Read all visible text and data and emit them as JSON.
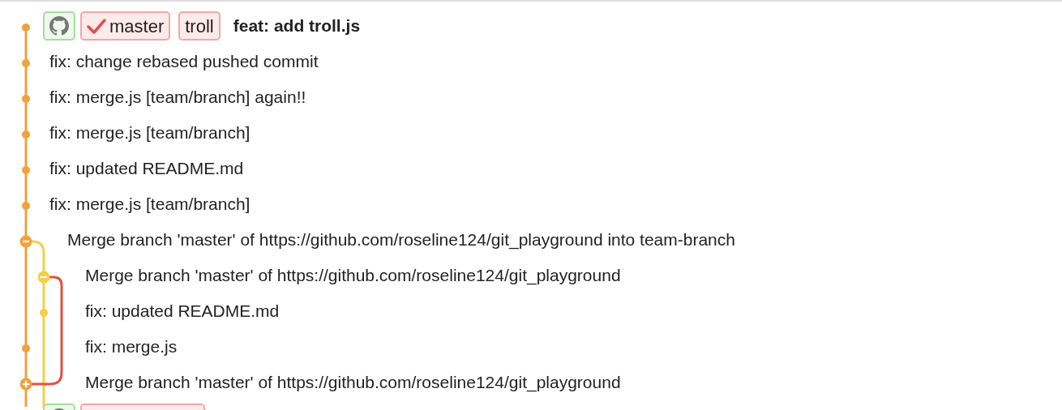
{
  "commits": [
    {
      "message": "feat: add troll.js",
      "bold": true,
      "kind": "commit",
      "tags": [
        {
          "kind": "github"
        },
        {
          "kind": "branch",
          "label": "master",
          "checked": true
        },
        {
          "kind": "branch",
          "label": "troll",
          "checked": false
        }
      ]
    },
    {
      "message": "fix: change rebased pushed commit",
      "bold": false,
      "kind": "commit"
    },
    {
      "message": "fix: merge.js [team/branch] again!!",
      "bold": false,
      "kind": "commit"
    },
    {
      "message": "fix: merge.js [team/branch]",
      "bold": false,
      "kind": "commit"
    },
    {
      "message": "fix: updated README.md",
      "bold": false,
      "kind": "commit"
    },
    {
      "message": "fix: merge.js [team/branch]",
      "bold": false,
      "kind": "commit"
    },
    {
      "message": "Merge branch 'master' of https://github.com/roseline124/git_playground into team-branch",
      "bold": false,
      "kind": "fork",
      "children": [
        {
          "message": "Merge branch 'master' of https://github.com/roseline124/git_playground",
          "bold": false,
          "kind": "fork"
        },
        {
          "message": "fix: updated README.md",
          "bold": false,
          "kind": "commit"
        }
      ]
    },
    {
      "message": "fix: merge.js",
      "bold": false,
      "kind": "commit"
    },
    {
      "message": "Merge branch 'master' of https://github.com/roseline124/git_playground",
      "bold": false,
      "kind": "join"
    },
    {
      "kind": "commit",
      "tags": [
        {
          "kind": "github"
        },
        {
          "kind": "branch"
        }
      ]
    }
  ]
}
